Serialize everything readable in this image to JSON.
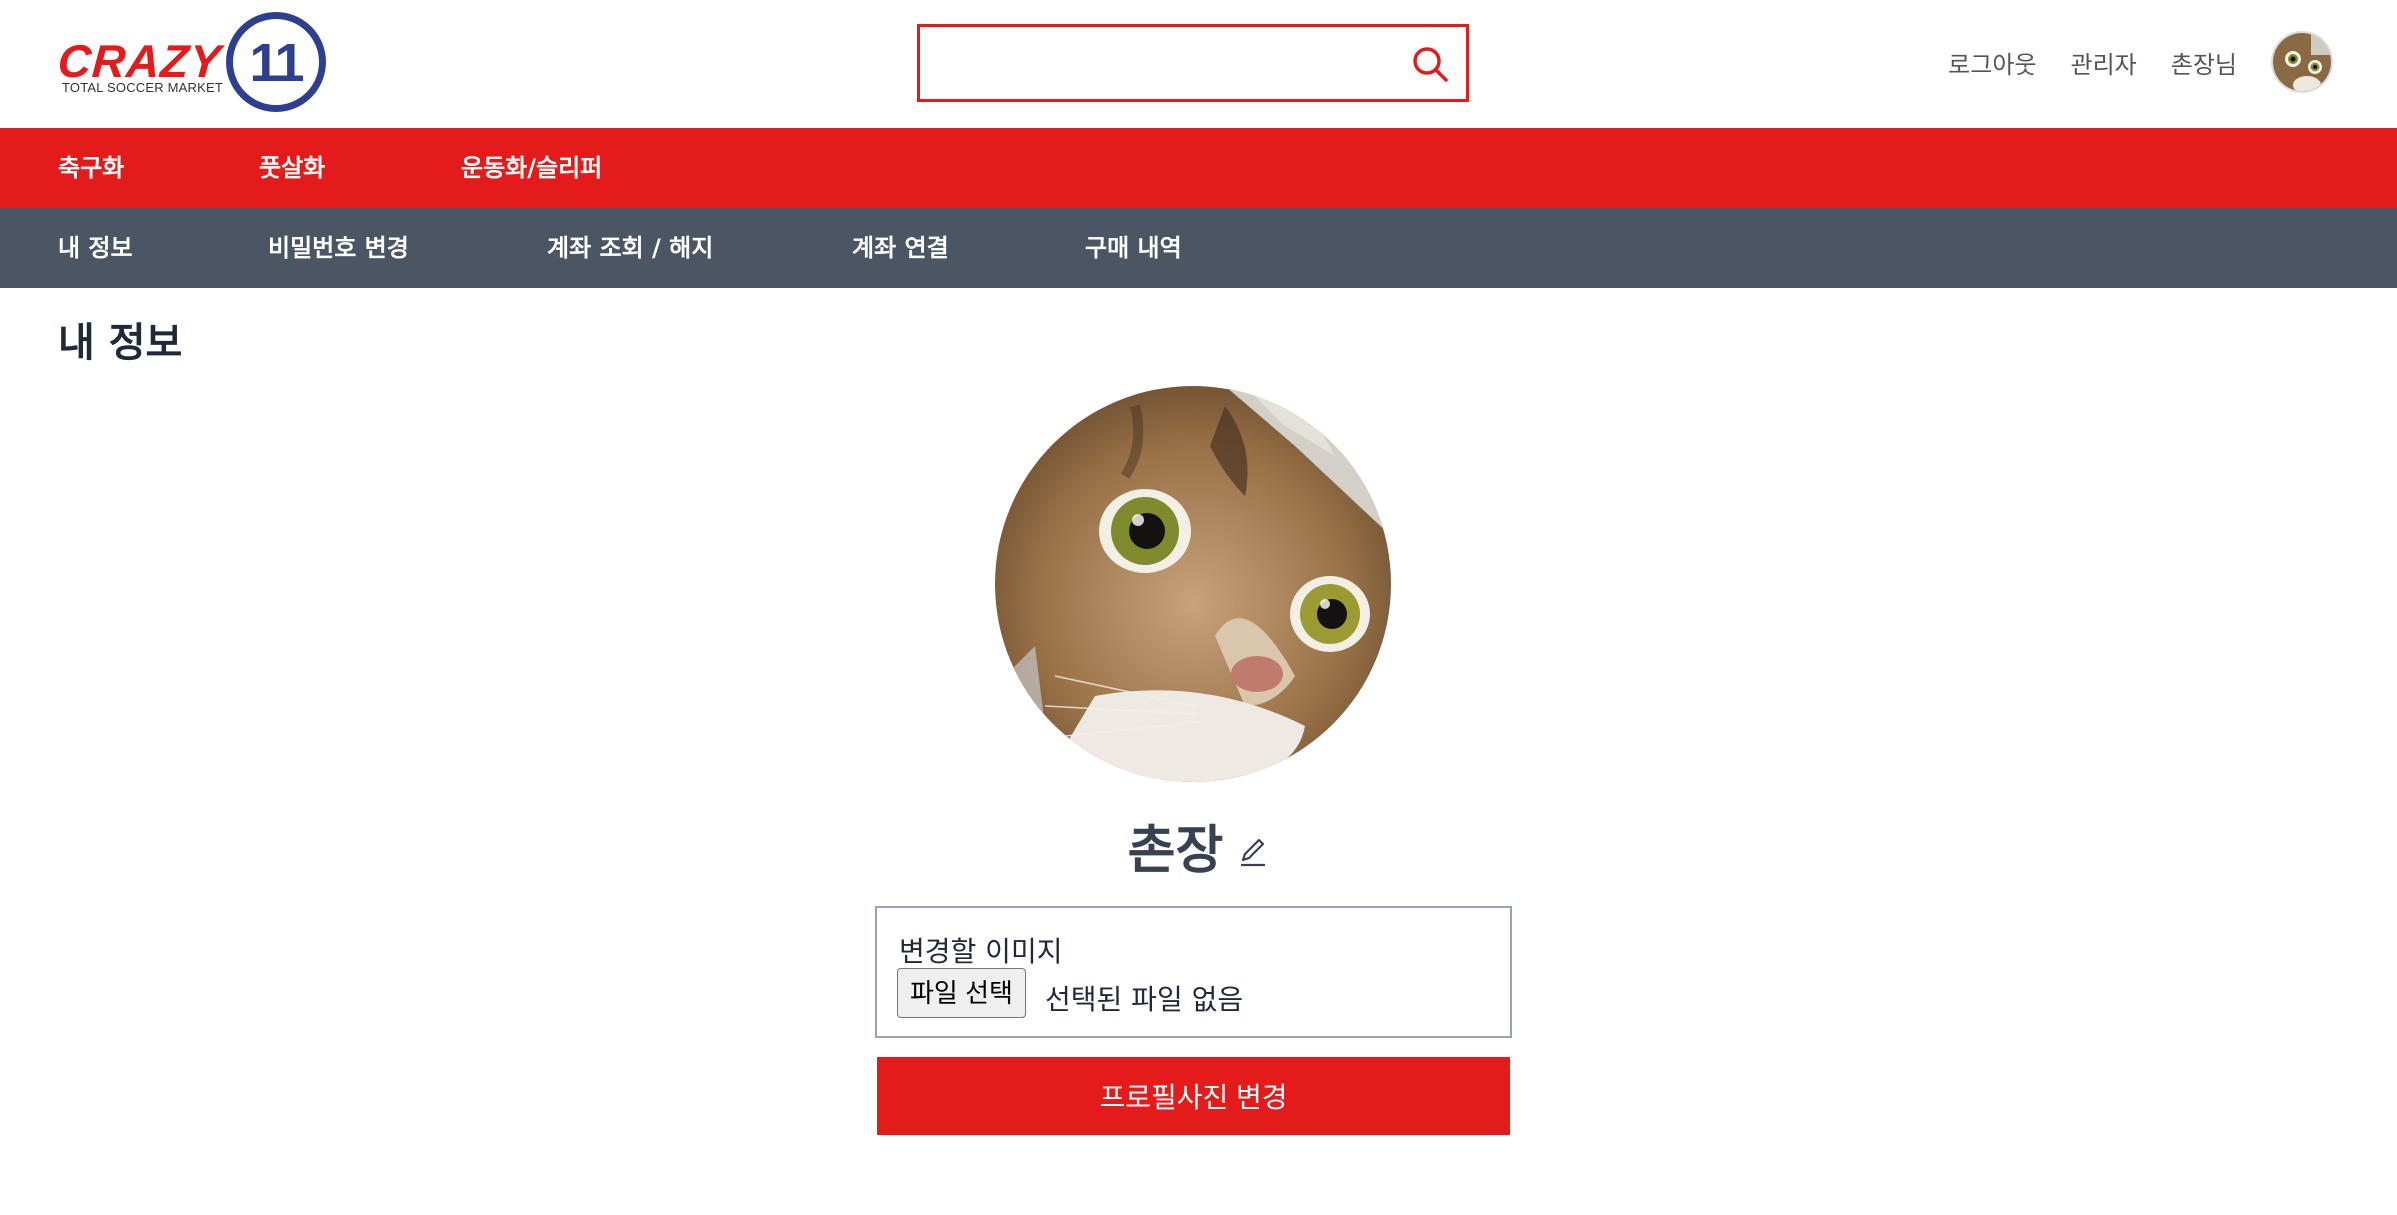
{
  "header": {
    "logo": {
      "word": "CRAZY",
      "number": "11",
      "tagline": "TOTAL SOCCER MARKET"
    },
    "search": {
      "value": "",
      "placeholder": ""
    },
    "user_links": {
      "logout": "로그아웃",
      "admin": "관리자",
      "user_greeting": "촌장님"
    }
  },
  "nav_main": {
    "items": [
      {
        "label": "축구화"
      },
      {
        "label": "풋살화"
      },
      {
        "label": "운동화/슬리퍼"
      }
    ]
  },
  "nav_sub": {
    "items": [
      {
        "label": "내 정보"
      },
      {
        "label": "비밀번호 변경"
      },
      {
        "label": "계좌 조회 / 해지"
      },
      {
        "label": "계좌 연결"
      },
      {
        "label": "구매 내역"
      }
    ]
  },
  "page": {
    "title": "내 정보"
  },
  "profile": {
    "name": "촌장",
    "upload_label": "변경할 이미지",
    "file_button": "파일 선택",
    "file_status": "선택된 파일 없음",
    "submit_label": "프로필사진 변경"
  },
  "colors": {
    "brand_red": "#e31b1b",
    "subnav_gray": "#4b5563",
    "logo_blue": "#2f3f8f"
  }
}
